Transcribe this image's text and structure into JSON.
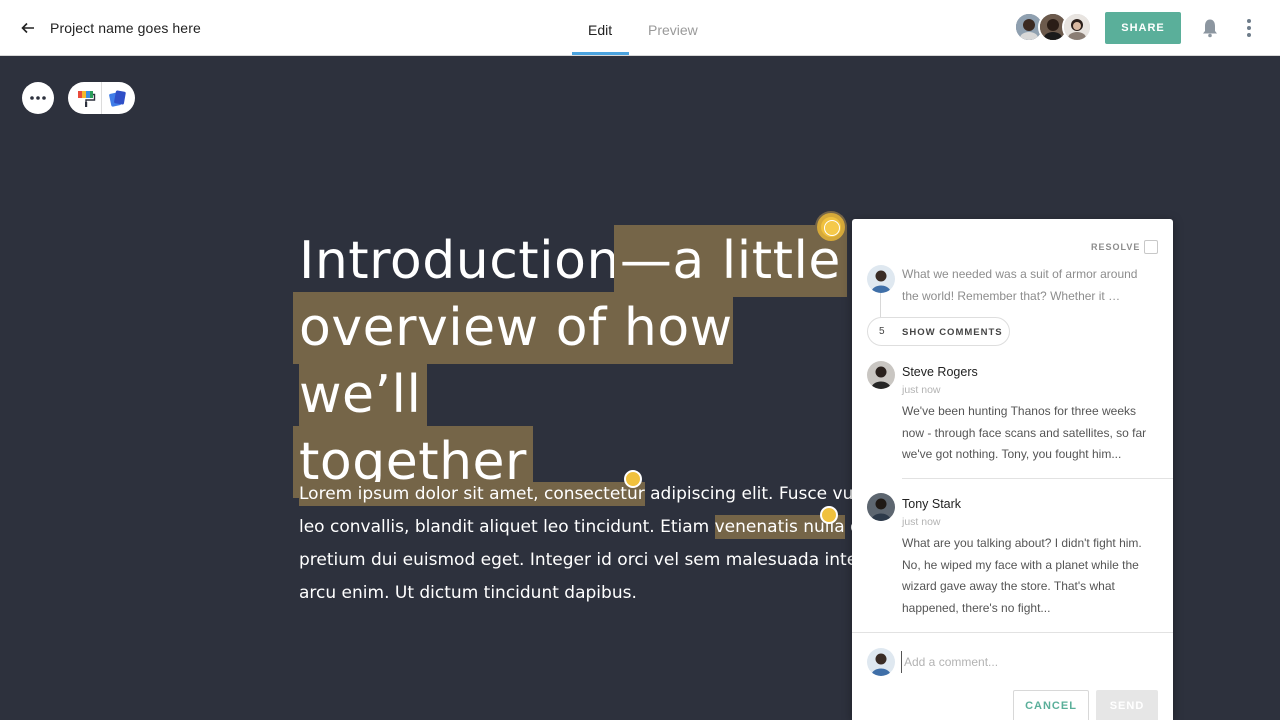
{
  "header": {
    "project_name": "Project name goes here",
    "tabs": [
      {
        "label": "Edit",
        "active": true
      },
      {
        "label": "Preview",
        "active": false
      }
    ],
    "share_label": "SHARE",
    "icons": [
      "back-arrow-icon",
      "bell-icon",
      "kebab-menu-icon"
    ],
    "collaborators_count": 3
  },
  "toolbar": {
    "icons": [
      "more-icon",
      "paint-roller-icon",
      "cards-icon"
    ]
  },
  "document": {
    "heading_plain": "Introduction",
    "heading_highlight_1": "—a little",
    "heading_highlight_2": "overview of how we’ll",
    "heading_highlight_3": "together",
    "para": {
      "line1_hl": "Lorem ipsum dolor sit amet, consectetur",
      "line1_rest": " adipiscing elit. Fusce vulp",
      "line2_pre": "leo convallis, blandit aliquet leo tincidunt. Etiam ",
      "line2_hl": "venenatis nulla",
      "line2_rest": " qu",
      "line3": "pretium dui euismod eget. Integer id orci vel sem malesuada interd",
      "line4": "arcu enim. Ut dictum tincidunt dapibus."
    }
  },
  "comments": {
    "resolve_label": "RESOLVE",
    "preview": "What we needed was a suit of armor around the world! Remember that? Whether it …",
    "show_count": "5",
    "show_label": "SHOW COMMENTS",
    "items": [
      {
        "name": "Steve Rogers",
        "time": "just now",
        "body": "We've been hunting Thanos for three weeks now - through face scans and satellites, so far we've got nothing. Tony, you fought him..."
      },
      {
        "name": "Tony Stark",
        "time": "just now",
        "body": "What are you talking about? I didn't fight him. No, he wiped my face with a planet while the wizard gave away the store. That's what happened, there's no fight..."
      }
    ],
    "input_placeholder": "Add a comment...",
    "cancel_label": "CANCEL",
    "send_label": "SEND"
  },
  "colors": {
    "background": "#2d313d",
    "highlight": "#756548",
    "marker": "#f0c13e",
    "accent": "#5aaf9a",
    "tab_underline": "#4aa3df"
  }
}
